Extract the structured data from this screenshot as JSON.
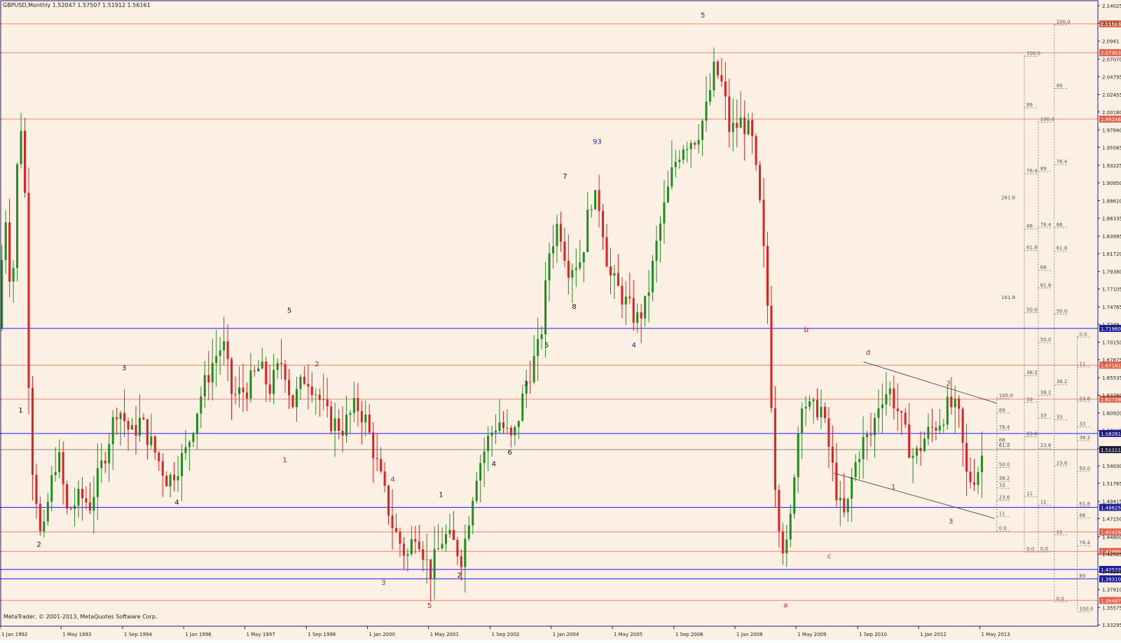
{
  "chart_data": {
    "type": "candlestick",
    "title": "GBPUSD,Monthly  1.52047 1.57507 1.51912 1.56161",
    "copyright": "MetaTrader, © 2001-2013, MetaQuotes Software Corp.",
    "colors": {
      "background": "#fcf0e4",
      "frame": "#1a1a7a",
      "up": "#1e8c1e",
      "down": "#e02020",
      "text": "#222222",
      "hline_red": "#e8846a",
      "hline_blue": "#1a1aff",
      "fib": "#8a8a8a"
    },
    "ylim": [
      1.335,
      2.145
    ],
    "xlim": [
      1992.0,
      2015.4
    ],
    "y_ticks": [
      2.14025,
      2.1175,
      2.0941,
      2.0707,
      2.04795,
      2.02455,
      2.0018,
      1.9784,
      1.95565,
      1.93225,
      1.9095,
      1.8861,
      1.86335,
      1.83995,
      1.8172,
      1.7938,
      1.77105,
      1.74765,
      1.7249,
      1.7015,
      1.67875,
      1.65535,
      1.6326,
      1.6092,
      1.58645,
      1.56305,
      1.5403,
      1.51765,
      1.49415,
      1.4715,
      1.448,
      1.42525,
      1.4025,
      1.3791,
      1.35575,
      1.33295
    ],
    "y_tick_labels": [
      "2.14025",
      "2.1175",
      "2.0941",
      "2.07070",
      "2.04795",
      "2.02455",
      "2.00180",
      "1.97840",
      "1.95565",
      "1.93225",
      "1.90950",
      "1.88610",
      "1.86335",
      "1.83995",
      "1.81720",
      "1.79380",
      "1.77105",
      "1.74765",
      "1.7249",
      "1.70150",
      "1.67875",
      "1.65535",
      "1.63260",
      "1.60920",
      "1.58645",
      "1.56305",
      "1.54030",
      "1.51765",
      "1.49415",
      "1.47150",
      "1.44800",
      "1.42525",
      "1.40250",
      "1.37910",
      "1.35575",
      "1.33295"
    ],
    "x_ticks": [
      {
        "label": "1 Jan 1992",
        "x": 1992.0
      },
      {
        "label": "1 May 1993",
        "x": 1993.33
      },
      {
        "label": "1 Sep 1994",
        "x": 1994.67
      },
      {
        "label": "1 Jan 1996",
        "x": 1996.0
      },
      {
        "label": "1 May 1997",
        "x": 1997.33
      },
      {
        "label": "1 Sep 1998",
        "x": 1998.67
      },
      {
        "label": "1 Jan 2000",
        "x": 2000.0
      },
      {
        "label": "1 May 2001",
        "x": 2001.33
      },
      {
        "label": "1 Sep 2002",
        "x": 2002.67
      },
      {
        "label": "1 Jan 2004",
        "x": 2004.0
      },
      {
        "label": "1 May 2005",
        "x": 2005.33
      },
      {
        "label": "1 Sep 2006",
        "x": 2006.67
      },
      {
        "label": "1 Jan 2008",
        "x": 2008.0
      },
      {
        "label": "1 May 2009",
        "x": 2009.33
      },
      {
        "label": "1 Sep 2010",
        "x": 2010.67
      },
      {
        "label": "1 Jan 2012",
        "x": 2012.0
      },
      {
        "label": "1 May 2013",
        "x": 2013.33
      }
    ],
    "price_path": [
      [
        1992.0,
        1.72
      ],
      [
        1992.15,
        1.88
      ],
      [
        1992.3,
        1.75
      ],
      [
        1992.45,
        1.98
      ],
      [
        1992.55,
        1.99
      ],
      [
        1992.7,
        1.56
      ],
      [
        1992.8,
        1.52
      ],
      [
        1992.95,
        1.43
      ],
      [
        1993.1,
        1.5
      ],
      [
        1993.3,
        1.56
      ],
      [
        1993.5,
        1.48
      ],
      [
        1993.8,
        1.5
      ],
      [
        1994.0,
        1.49
      ],
      [
        1994.3,
        1.55
      ],
      [
        1994.6,
        1.62
      ],
      [
        1994.9,
        1.58
      ],
      [
        1995.1,
        1.6
      ],
      [
        1995.4,
        1.56
      ],
      [
        1995.7,
        1.52
      ],
      [
        1995.9,
        1.54
      ],
      [
        1996.1,
        1.56
      ],
      [
        1996.4,
        1.63
      ],
      [
        1996.7,
        1.68
      ],
      [
        1996.9,
        1.7
      ],
      [
        1997.1,
        1.63
      ],
      [
        1997.4,
        1.64
      ],
      [
        1997.7,
        1.67
      ],
      [
        1997.9,
        1.64
      ],
      [
        1998.2,
        1.68
      ],
      [
        1998.4,
        1.62
      ],
      [
        1998.7,
        1.66
      ],
      [
        1998.9,
        1.64
      ],
      [
        1999.2,
        1.6
      ],
      [
        1999.5,
        1.59
      ],
      [
        1999.8,
        1.62
      ],
      [
        2000.0,
        1.6
      ],
      [
        2000.3,
        1.53
      ],
      [
        2000.6,
        1.46
      ],
      [
        2000.9,
        1.42
      ],
      [
        2001.1,
        1.46
      ],
      [
        2001.4,
        1.4
      ],
      [
        2001.7,
        1.45
      ],
      [
        2001.9,
        1.44
      ],
      [
        2002.1,
        1.42
      ],
      [
        2002.4,
        1.53
      ],
      [
        2002.7,
        1.58
      ],
      [
        2002.9,
        1.6
      ],
      [
        2003.2,
        1.57
      ],
      [
        2003.5,
        1.65
      ],
      [
        2003.8,
        1.7
      ],
      [
        2004.0,
        1.82
      ],
      [
        2004.2,
        1.86
      ],
      [
        2004.4,
        1.8
      ],
      [
        2004.7,
        1.81
      ],
      [
        2004.9,
        1.89
      ],
      [
        2005.1,
        1.88
      ],
      [
        2005.3,
        1.79
      ],
      [
        2005.6,
        1.76
      ],
      [
        2005.9,
        1.73
      ],
      [
        2006.1,
        1.75
      ],
      [
        2006.4,
        1.85
      ],
      [
        2006.7,
        1.93
      ],
      [
        2006.9,
        1.96
      ],
      [
        2007.2,
        1.97
      ],
      [
        2007.4,
        2.0
      ],
      [
        2007.6,
        2.06
      ],
      [
        2007.8,
        2.03
      ],
      [
        2007.9,
        1.98
      ],
      [
        2008.0,
        1.98
      ],
      [
        2008.2,
        1.99
      ],
      [
        2008.4,
        1.97
      ],
      [
        2008.6,
        1.87
      ],
      [
        2008.75,
        1.75
      ],
      [
        2008.9,
        1.53
      ],
      [
        2009.05,
        1.44
      ],
      [
        2009.2,
        1.43
      ],
      [
        2009.35,
        1.55
      ],
      [
        2009.5,
        1.63
      ],
      [
        2009.7,
        1.61
      ],
      [
        2009.9,
        1.62
      ],
      [
        2010.1,
        1.56
      ],
      [
        2010.3,
        1.49
      ],
      [
        2010.45,
        1.47
      ],
      [
        2010.6,
        1.53
      ],
      [
        2010.8,
        1.57
      ],
      [
        2011.0,
        1.58
      ],
      [
        2011.2,
        1.63
      ],
      [
        2011.4,
        1.64
      ],
      [
        2011.6,
        1.61
      ],
      [
        2011.8,
        1.57
      ],
      [
        2011.95,
        1.55
      ],
      [
        2012.2,
        1.58
      ],
      [
        2012.5,
        1.6
      ],
      [
        2012.7,
        1.62
      ],
      [
        2012.9,
        1.61
      ],
      [
        2013.1,
        1.52
      ],
      [
        2013.3,
        1.53
      ],
      [
        2013.45,
        1.56
      ]
    ],
    "hlines": [
      {
        "y": 2.11666,
        "color": "red",
        "label": "2.11666"
      },
      {
        "y": 2.07903,
        "color": "red",
        "label": "2.07903"
      },
      {
        "y": 1.99246,
        "color": "red",
        "label": "1.99246"
      },
      {
        "y": 1.7196,
        "color": "blue",
        "label": "1.71960"
      },
      {
        "y": 1.67161,
        "color": "red",
        "label": "1.67161"
      },
      {
        "y": 1.62739,
        "color": "red",
        "label": "1.62739"
      },
      {
        "y": 1.58261,
        "color": "blue",
        "label": "1.58261"
      },
      {
        "y": 1.56161,
        "color": "current",
        "label": "1.56161"
      },
      {
        "y": 1.48625,
        "color": "blue",
        "label": "1.48625"
      },
      {
        "y": 1.45426,
        "color": "red",
        "label": "1.45426"
      },
      {
        "y": 1.42886,
        "color": "red",
        "label": "1.42886"
      },
      {
        "y": 1.40533,
        "color": "blue",
        "label": "1.40533"
      },
      {
        "y": 1.3931,
        "color": "blue",
        "label": "1.39310"
      },
      {
        "y": 1.36487,
        "color": "red",
        "label": "1.36487"
      }
    ],
    "wave_labels": [
      {
        "t": "1",
        "x": 1992.45,
        "y": 1.61,
        "c": "black"
      },
      {
        "t": "2",
        "x": 1992.85,
        "y": 1.435,
        "c": "black"
      },
      {
        "t": "3",
        "x": 1994.7,
        "y": 1.665,
        "c": "black"
      },
      {
        "t": "4",
        "x": 1995.85,
        "y": 1.49,
        "c": "black"
      },
      {
        "t": "5",
        "x": 1998.3,
        "y": 1.74,
        "c": "black"
      },
      {
        "t": "2",
        "x": 1998.9,
        "y": 1.67,
        "c": "red"
      },
      {
        "t": "1",
        "x": 1998.2,
        "y": 1.545,
        "c": "red"
      },
      {
        "t": "4",
        "x": 2000.55,
        "y": 1.52,
        "c": "red"
      },
      {
        "t": "3",
        "x": 2000.35,
        "y": 1.385,
        "c": "red"
      },
      {
        "t": "5",
        "x": 2001.35,
        "y": 1.355,
        "c": "red"
      },
      {
        "t": "1",
        "x": 2001.6,
        "y": 1.5,
        "c": "black"
      },
      {
        "t": "2",
        "x": 2002.0,
        "y": 1.395,
        "c": "black"
      },
      {
        "t": "4",
        "x": 2002.75,
        "y": 1.54,
        "c": "black"
      },
      {
        "t": "6",
        "x": 2003.1,
        "y": 1.555,
        "c": "black"
      },
      {
        "t": "3",
        "x": 2003.45,
        "y": 1.645,
        "c": "black"
      },
      {
        "t": "5",
        "x": 2003.9,
        "y": 1.695,
        "c": "black"
      },
      {
        "t": "7",
        "x": 2004.3,
        "y": 1.915,
        "c": "black"
      },
      {
        "t": "8",
        "x": 2004.5,
        "y": 1.745,
        "c": "black"
      },
      {
        "t": "93",
        "x": 2005.0,
        "y": 1.96,
        "c": "blue"
      },
      {
        "t": "4",
        "x": 2005.8,
        "y": 1.695,
        "c": "blue"
      },
      {
        "t": "5",
        "x": 2007.3,
        "y": 2.125,
        "c": "blue"
      },
      {
        "t": "b",
        "x": 2009.55,
        "y": 1.715,
        "c": "red"
      },
      {
        "t": "d",
        "x": 2010.9,
        "y": 1.685,
        "c": "red"
      },
      {
        "t": "2",
        "x": 2012.65,
        "y": 1.645,
        "c": "red"
      },
      {
        "t": "1",
        "x": 2011.45,
        "y": 1.51,
        "c": "red"
      },
      {
        "t": "3",
        "x": 2012.7,
        "y": 1.465,
        "c": "red"
      },
      {
        "t": "c",
        "x": 2010.05,
        "y": 1.42,
        "c": "red"
      },
      {
        "t": "a",
        "x": 2009.1,
        "y": 1.356,
        "c": "red"
      }
    ],
    "channel_lines": [
      {
        "x1": 2010.8,
        "y1": 1.676,
        "x2": 2013.7,
        "y2": 1.622
      },
      {
        "x1": 2010.15,
        "y1": 1.531,
        "x2": 2013.65,
        "y2": 1.472
      }
    ],
    "fib_columns": [
      {
        "x": 2013.7,
        "y_top": 1.63,
        "y_bot": 1.455,
        "ticks": [
          {
            "y": 1.63,
            "t": "100.0"
          },
          {
            "y": 1.611,
            "t": "89"
          },
          {
            "y": 1.589,
            "t": "76.4"
          },
          {
            "y": 1.572,
            "t": "66"
          },
          {
            "y": 1.565,
            "t": "61.8"
          },
          {
            "y": 1.54,
            "t": "50.0"
          },
          {
            "y": 1.522,
            "t": "38.2"
          },
          {
            "y": 1.513,
            "t": "33"
          },
          {
            "y": 1.497,
            "t": "23.6"
          },
          {
            "y": 1.476,
            "t": "11"
          },
          {
            "y": 1.457,
            "t": "0.0"
          }
        ],
        "left": true
      },
      {
        "x": 2013.75,
        "y_top": 1.89,
        "y_bot": 1.755,
        "ticks": [
          {
            "y": 1.888,
            "t": "261.8"
          },
          {
            "y": 1.758,
            "t": "161.8"
          }
        ],
        "left": true,
        "nolines": true
      },
      {
        "x": 2014.3,
        "y_top": 2.076,
        "y_bot": 1.43,
        "ticks": [
          {
            "y": 2.076,
            "t": "100.0"
          },
          {
            "y": 2.009,
            "t": "89"
          },
          {
            "y": 1.923,
            "t": "76.4"
          },
          {
            "y": 1.851,
            "t": "66"
          },
          {
            "y": 1.823,
            "t": "61.8"
          },
          {
            "y": 1.742,
            "t": "50.0"
          },
          {
            "y": 1.66,
            "t": "38.2"
          },
          {
            "y": 1.625,
            "t": "33"
          },
          {
            "y": 1.58,
            "t": "23.6"
          },
          {
            "y": 1.502,
            "t": "11"
          },
          {
            "y": 1.43,
            "t": "0.0"
          }
        ]
      },
      {
        "x": 2014.6,
        "y_top": 1.99,
        "y_bot": 1.43,
        "ticks": [
          {
            "y": 1.99,
            "t": "100.0"
          },
          {
            "y": 1.926,
            "t": "89"
          },
          {
            "y": 1.853,
            "t": "76.4"
          },
          {
            "y": 1.797,
            "t": "66"
          },
          {
            "y": 1.774,
            "t": "61.8"
          },
          {
            "y": 1.703,
            "t": "50.0"
          },
          {
            "y": 1.634,
            "t": "38.2"
          },
          {
            "y": 1.604,
            "t": "33"
          },
          {
            "y": 1.565,
            "t": "23.6"
          },
          {
            "y": 1.491,
            "t": "11"
          },
          {
            "y": 1.43,
            "t": "0.0"
          }
        ]
      },
      {
        "x": 2014.95,
        "y_top": 2.117,
        "y_bot": 1.365,
        "ticks": [
          {
            "y": 2.117,
            "t": "100.0"
          },
          {
            "y": 2.034,
            "t": "89"
          },
          {
            "y": 1.935,
            "t": "76.4"
          },
          {
            "y": 1.853,
            "t": "66"
          },
          {
            "y": 1.822,
            "t": "61.8"
          },
          {
            "y": 1.74,
            "t": "50.0"
          },
          {
            "y": 1.648,
            "t": "38.2"
          },
          {
            "y": 1.602,
            "t": "33"
          },
          {
            "y": 1.542,
            "t": "23.6"
          },
          {
            "y": 1.452,
            "t": "11"
          },
          {
            "y": 1.365,
            "t": "0.0"
          }
        ]
      },
      {
        "x": 2015.45,
        "y_top": 1.71,
        "y_bot": 1.352,
        "ticks": [
          {
            "y": 1.71,
            "t": "0.0"
          },
          {
            "y": 1.671,
            "t": "11"
          },
          {
            "y": 1.626,
            "t": "23.6"
          },
          {
            "y": 1.593,
            "t": "33"
          },
          {
            "y": 1.575,
            "t": "38.2"
          },
          {
            "y": 1.535,
            "t": "50.0"
          },
          {
            "y": 1.489,
            "t": "61.8"
          },
          {
            "y": 1.474,
            "t": "66"
          },
          {
            "y": 1.438,
            "t": "76.4"
          },
          {
            "y": 1.395,
            "t": "89"
          },
          {
            "y": 1.352,
            "t": "100.0"
          }
        ]
      }
    ]
  }
}
